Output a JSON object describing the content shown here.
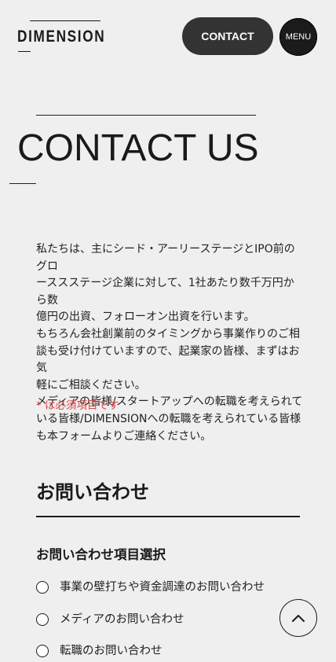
{
  "header": {
    "logo": "DIMENSION",
    "contact_label": "CONTACT",
    "menu_label": "MENU"
  },
  "page": {
    "title": "CONTACT US"
  },
  "intro": {
    "lines": [
      "私たちは、主にシード・アーリーステージとIPO前のグロ",
      "ーススステージ企業に対して、1社あたり数千万円から数",
      "億円の出資、フォローオン出資を行います。",
      "もちろん会社創業前のタイミングから事業作りのご相",
      "談も受け付けていますので、起業家の皆様、まずはお気",
      "軽にご相談ください。",
      "メディアの皆様/スタートアップへの転職を考えられて",
      "いる皆様/DIMENSIONへの転職を考えられている皆様",
      "も本フォームよりご連絡ください。"
    ],
    "required_note": "* は必須項目です"
  },
  "form": {
    "section_heading": "お問い合わせ",
    "inquiry_type_label": "お問い合わせ項目選択",
    "options": [
      "事業の壁打ちや資金調達のお問い合わせ",
      "メディアのお問い合わせ",
      "転職のお問い合わせ"
    ]
  },
  "icons": {
    "back_to_top": "chevron-up-icon"
  }
}
